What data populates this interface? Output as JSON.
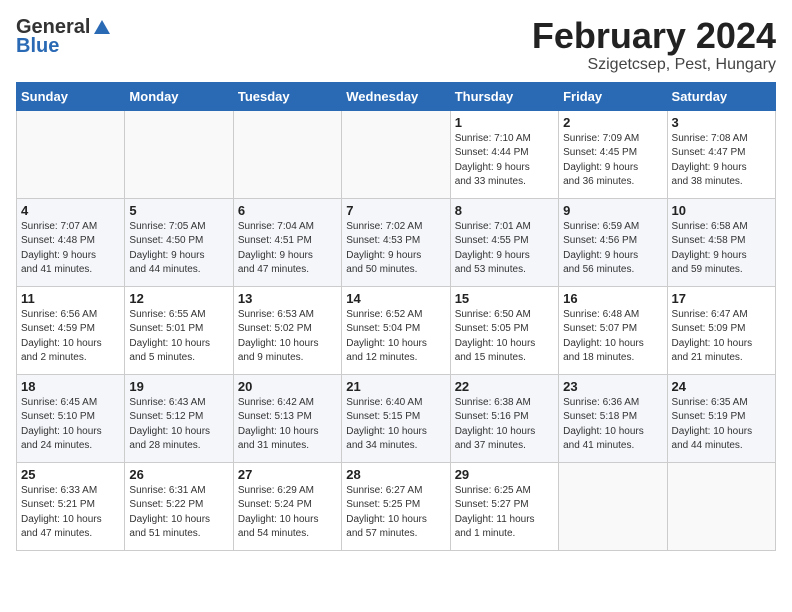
{
  "header": {
    "logo_general": "General",
    "logo_blue": "Blue",
    "month_title": "February 2024",
    "location": "Szigetcsep, Pest, Hungary"
  },
  "weekdays": [
    "Sunday",
    "Monday",
    "Tuesday",
    "Wednesday",
    "Thursday",
    "Friday",
    "Saturday"
  ],
  "weeks": [
    [
      {
        "day": "",
        "info": ""
      },
      {
        "day": "",
        "info": ""
      },
      {
        "day": "",
        "info": ""
      },
      {
        "day": "",
        "info": ""
      },
      {
        "day": "1",
        "info": "Sunrise: 7:10 AM\nSunset: 4:44 PM\nDaylight: 9 hours\nand 33 minutes."
      },
      {
        "day": "2",
        "info": "Sunrise: 7:09 AM\nSunset: 4:45 PM\nDaylight: 9 hours\nand 36 minutes."
      },
      {
        "day": "3",
        "info": "Sunrise: 7:08 AM\nSunset: 4:47 PM\nDaylight: 9 hours\nand 38 minutes."
      }
    ],
    [
      {
        "day": "4",
        "info": "Sunrise: 7:07 AM\nSunset: 4:48 PM\nDaylight: 9 hours\nand 41 minutes."
      },
      {
        "day": "5",
        "info": "Sunrise: 7:05 AM\nSunset: 4:50 PM\nDaylight: 9 hours\nand 44 minutes."
      },
      {
        "day": "6",
        "info": "Sunrise: 7:04 AM\nSunset: 4:51 PM\nDaylight: 9 hours\nand 47 minutes."
      },
      {
        "day": "7",
        "info": "Sunrise: 7:02 AM\nSunset: 4:53 PM\nDaylight: 9 hours\nand 50 minutes."
      },
      {
        "day": "8",
        "info": "Sunrise: 7:01 AM\nSunset: 4:55 PM\nDaylight: 9 hours\nand 53 minutes."
      },
      {
        "day": "9",
        "info": "Sunrise: 6:59 AM\nSunset: 4:56 PM\nDaylight: 9 hours\nand 56 minutes."
      },
      {
        "day": "10",
        "info": "Sunrise: 6:58 AM\nSunset: 4:58 PM\nDaylight: 9 hours\nand 59 minutes."
      }
    ],
    [
      {
        "day": "11",
        "info": "Sunrise: 6:56 AM\nSunset: 4:59 PM\nDaylight: 10 hours\nand 2 minutes."
      },
      {
        "day": "12",
        "info": "Sunrise: 6:55 AM\nSunset: 5:01 PM\nDaylight: 10 hours\nand 5 minutes."
      },
      {
        "day": "13",
        "info": "Sunrise: 6:53 AM\nSunset: 5:02 PM\nDaylight: 10 hours\nand 9 minutes."
      },
      {
        "day": "14",
        "info": "Sunrise: 6:52 AM\nSunset: 5:04 PM\nDaylight: 10 hours\nand 12 minutes."
      },
      {
        "day": "15",
        "info": "Sunrise: 6:50 AM\nSunset: 5:05 PM\nDaylight: 10 hours\nand 15 minutes."
      },
      {
        "day": "16",
        "info": "Sunrise: 6:48 AM\nSunset: 5:07 PM\nDaylight: 10 hours\nand 18 minutes."
      },
      {
        "day": "17",
        "info": "Sunrise: 6:47 AM\nSunset: 5:09 PM\nDaylight: 10 hours\nand 21 minutes."
      }
    ],
    [
      {
        "day": "18",
        "info": "Sunrise: 6:45 AM\nSunset: 5:10 PM\nDaylight: 10 hours\nand 24 minutes."
      },
      {
        "day": "19",
        "info": "Sunrise: 6:43 AM\nSunset: 5:12 PM\nDaylight: 10 hours\nand 28 minutes."
      },
      {
        "day": "20",
        "info": "Sunrise: 6:42 AM\nSunset: 5:13 PM\nDaylight: 10 hours\nand 31 minutes."
      },
      {
        "day": "21",
        "info": "Sunrise: 6:40 AM\nSunset: 5:15 PM\nDaylight: 10 hours\nand 34 minutes."
      },
      {
        "day": "22",
        "info": "Sunrise: 6:38 AM\nSunset: 5:16 PM\nDaylight: 10 hours\nand 37 minutes."
      },
      {
        "day": "23",
        "info": "Sunrise: 6:36 AM\nSunset: 5:18 PM\nDaylight: 10 hours\nand 41 minutes."
      },
      {
        "day": "24",
        "info": "Sunrise: 6:35 AM\nSunset: 5:19 PM\nDaylight: 10 hours\nand 44 minutes."
      }
    ],
    [
      {
        "day": "25",
        "info": "Sunrise: 6:33 AM\nSunset: 5:21 PM\nDaylight: 10 hours\nand 47 minutes."
      },
      {
        "day": "26",
        "info": "Sunrise: 6:31 AM\nSunset: 5:22 PM\nDaylight: 10 hours\nand 51 minutes."
      },
      {
        "day": "27",
        "info": "Sunrise: 6:29 AM\nSunset: 5:24 PM\nDaylight: 10 hours\nand 54 minutes."
      },
      {
        "day": "28",
        "info": "Sunrise: 6:27 AM\nSunset: 5:25 PM\nDaylight: 10 hours\nand 57 minutes."
      },
      {
        "day": "29",
        "info": "Sunrise: 6:25 AM\nSunset: 5:27 PM\nDaylight: 11 hours\nand 1 minute."
      },
      {
        "day": "",
        "info": ""
      },
      {
        "day": "",
        "info": ""
      }
    ]
  ]
}
